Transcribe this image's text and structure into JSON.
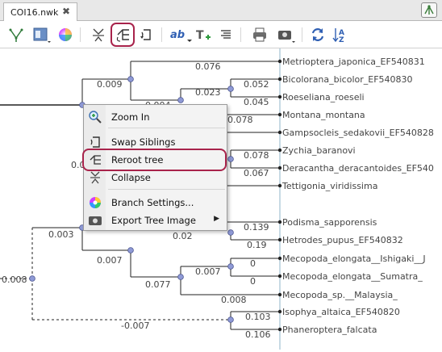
{
  "tab": {
    "title": "COI16.nwk",
    "close_glyph": "✖"
  },
  "toolbar": {
    "icons": [
      "tree-layout-icon",
      "layout-menu-icon",
      "color-wheel-icon",
      "collapse-icon",
      "reroot-tree-icon",
      "swap-siblings-icon",
      "label-format-icon",
      "add-label-icon",
      "align-icon",
      "print-icon",
      "export-image-icon",
      "refresh-icon",
      "sort-az-icon"
    ],
    "label_format_text": "ab"
  },
  "tree": {
    "leaves": [
      "Metrioptera_japonica_EF540831",
      "Bicolorana_bicolor_EF540830",
      "Roeseliana_roeseli",
      "Montana_montana",
      "Gampsocleis_sedakovii_EF540828",
      "Zychia_baranovi",
      "Deracantha_deracantoides_EF540",
      "Tettigonia_viridissima",
      "Podisma_sapporensis",
      "Hetrodes_pupus_EF540832",
      "Mecopoda_elongata__Ishigaki__J",
      "Mecopoda_elongata__Sumatra_",
      "Mecopoda_sp.__Malaysia_",
      "Isophya_altaica_EF540820",
      "Phaneroptera_falcata"
    ],
    "branch_labels": [
      "0.076",
      "0.009",
      "0.052",
      "0.023",
      "0.045",
      "0.004",
      "0.078",
      "0.078",
      "0.067",
      "0.0",
      "0.139",
      "0.02",
      "0.19",
      "0.003",
      "0.007",
      "0",
      "0.007",
      "0",
      "0.077",
      "0.008",
      "0.103",
      "-0.007",
      "0.106",
      "0.008"
    ]
  },
  "context_menu": {
    "items": [
      {
        "label": "Zoom In",
        "icon": "zoom-in-icon"
      },
      {
        "label": "Swap Siblings",
        "icon": "swap-siblings-icon"
      },
      {
        "label": "Reroot tree",
        "icon": "reroot-tree-icon"
      },
      {
        "label": "Collapse",
        "icon": "collapse-icon"
      },
      {
        "label": "Branch Settings...",
        "icon": "color-wheel-icon"
      },
      {
        "label": "Export Tree Image",
        "icon": "export-image-icon",
        "submenu_arrow": "▶"
      }
    ]
  },
  "colors": {
    "highlight": "#a8234b",
    "node": "#8f9ad6",
    "branch": "#222222"
  }
}
